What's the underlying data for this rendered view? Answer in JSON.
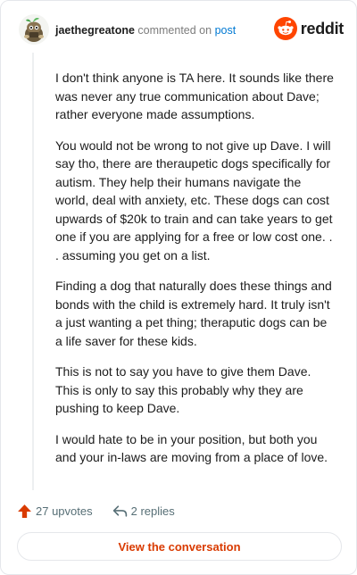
{
  "header": {
    "username": "jaethegreatone",
    "action_text": "commented on",
    "post_link": "post",
    "brand": "reddit",
    "brand_color": "#ff4500",
    "avatar_icon": "avatar-icon",
    "logo_icon": "reddit-snoo-icon"
  },
  "comment": {
    "paragraphs": [
      "I don't think anyone is TA here. It sounds like there was never any true communication about Dave; rather everyone made assumptions.",
      "You would not be wrong to not give up Dave. I will say tho, there are theraupetic dogs specifically for autism. They help their humans navigate the world, deal with anxiety, etc. These dogs can cost upwards of $20k to train and can take years to get one if you are applying for a free or low cost one. . . assuming you get on a list.",
      "Finding a dog that naturally does these things and bonds with the child is extremely hard. It truly isn't a just wanting a pet thing; theraputic dogs can be a life saver for these kids.",
      "This is not to say you have to give them Dave. This is only to say this probably why they are pushing to keep Dave.",
      "I would hate to be in your position, but both you and your in-laws are moving from a place of love."
    ]
  },
  "actions": {
    "upvotes": "27 upvotes",
    "replies": "2 replies",
    "upvote_icon": "upvote-arrow-icon",
    "reply_icon": "reply-arrow-icon",
    "upvote_color": "#d93a00"
  },
  "cta": {
    "label": "View the conversation",
    "color": "#d93a00"
  }
}
